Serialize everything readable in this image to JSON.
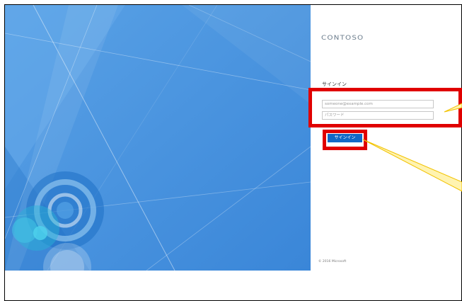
{
  "brand": {
    "logo_text": "CONTOSO"
  },
  "signin": {
    "title": "サインイン",
    "email_placeholder": "someone@example.com",
    "password_placeholder": "パスワード",
    "submit_label": "サインイン"
  },
  "footer": {
    "copyright": "© 2016 Microsoft"
  },
  "colors": {
    "hero_blue": "#3f8fdc",
    "button_blue": "#1168c6",
    "highlight_red": "#e00000",
    "callout_yellow": "#f2c200"
  }
}
